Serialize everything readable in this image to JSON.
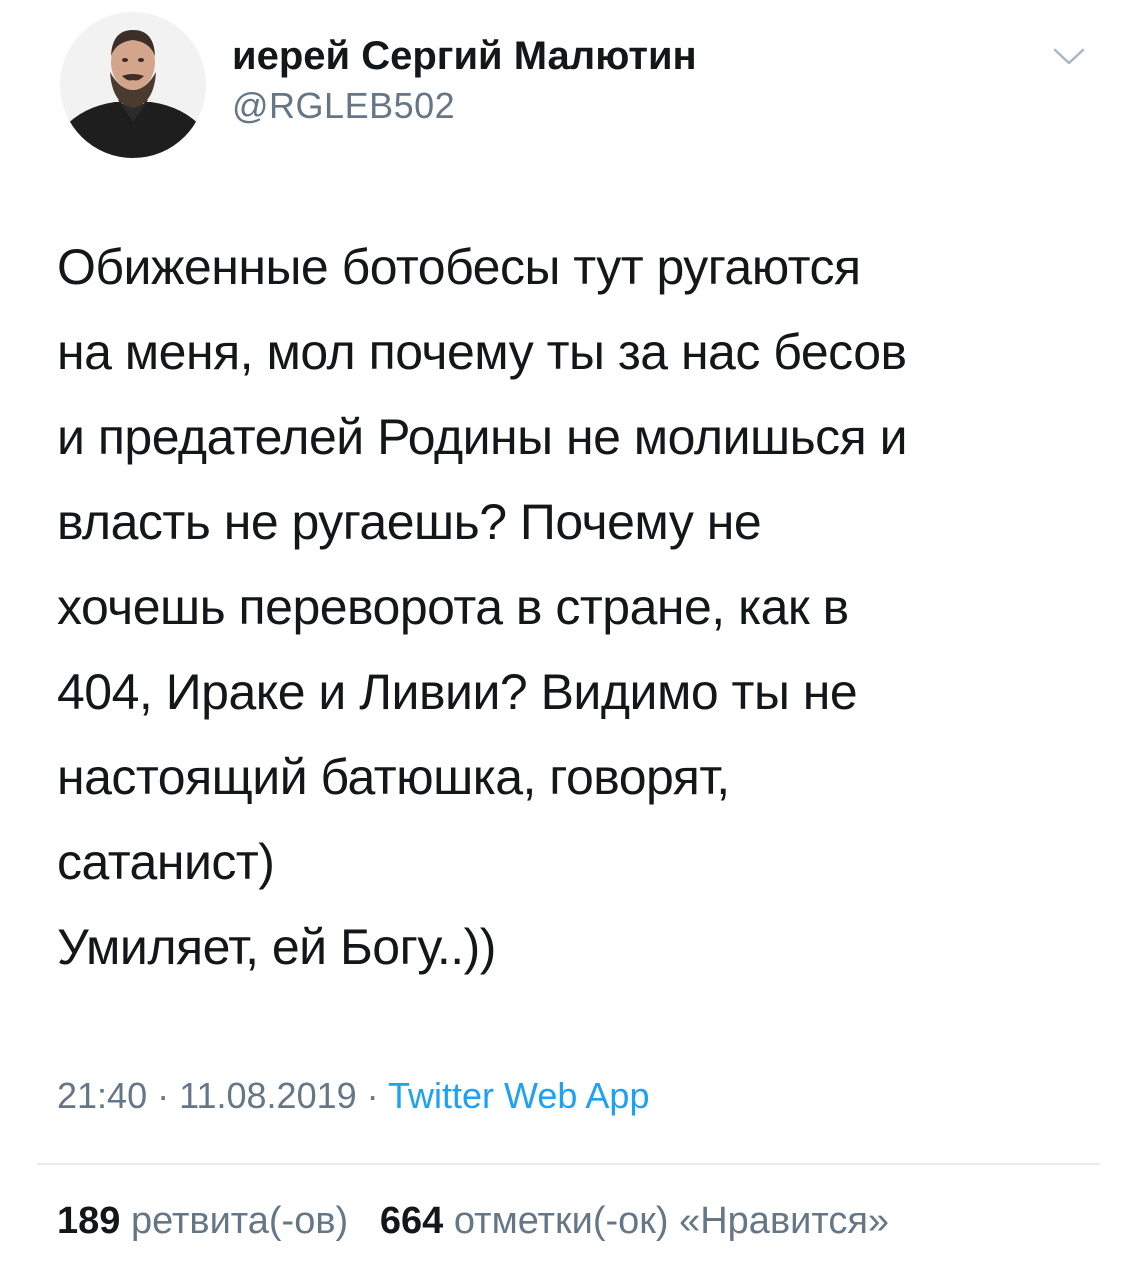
{
  "author": {
    "name": "иерей Сергий Малютин",
    "handle": "@RGLEB502"
  },
  "tweet": {
    "lines": [
      "Обиженные ботобесы тут ругаются",
      "на меня, мол почему ты за нас  бесов",
      "и предателей Родины не молишься и",
      "власть не ругаешь? Почему не",
      "хочешь переворота в стране, как в",
      "404, Ираке и Ливии? Видимо ты не",
      "настоящий батюшка, говорят,",
      "сатанист)",
      "Умиляет, ей Богу..))"
    ]
  },
  "meta": {
    "time": "21:40",
    "separator": "·",
    "date": "11.08.2019",
    "source": "Twitter Web App"
  },
  "stats": {
    "retweets_count": "189",
    "retweets_label": "ретвита(-ов)",
    "likes_count": "664",
    "likes_label": "отметки(-ок) «Нравится»"
  },
  "colors": {
    "text": "#14171a",
    "secondary": "#657786",
    "link": "#1da1f2",
    "divider": "#e6ecf0"
  },
  "icons": {
    "avatar": "profile-photo",
    "menu": "chevron-down-icon"
  }
}
